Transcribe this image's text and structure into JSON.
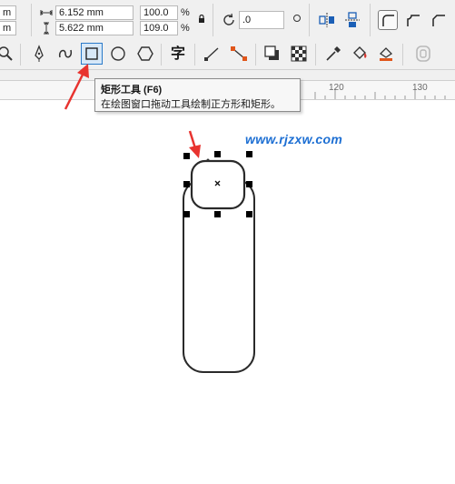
{
  "property_bar": {
    "x_value_fragment": "m",
    "y_value_fragment": "m",
    "width_value": "6.152 mm",
    "height_value": "5.622 mm",
    "scale_x": "100.0",
    "scale_y": "109.0",
    "percent_symbol": "%",
    "rotation_value": ".0",
    "icons": {
      "width": "width-arrows-icon",
      "height": "height-arrows-icon",
      "lock": "lock-ratio-icon",
      "rotate": "rotate-icon",
      "mirror_h": "mirror-horizontal-icon",
      "mirror_v": "mirror-vertical-icon",
      "corner_round": "round-corner-icon",
      "corner_scallop": "scalloped-corner-icon",
      "corner_chamfer": "chamfer-corner-icon"
    }
  },
  "toolbox": {
    "icons": [
      "zoom-icon",
      "pen-icon",
      "freehand-icon",
      "rectangle-tool-icon",
      "ellipse-tool-icon",
      "polygon-tool-icon",
      "text-tool-icon",
      "line-connector-icon",
      "connector-icon",
      "drop-shadow-icon",
      "transparency-icon",
      "eyedropper-icon",
      "fill-bucket-icon",
      "smart-fill-icon",
      "outline-icon"
    ],
    "text_tool_glyph": "字",
    "active": "rectangle-tool-icon"
  },
  "ruler": {
    "labels": [
      "120",
      "130"
    ]
  },
  "tooltip": {
    "title": "矩形工具 (F6)",
    "description": "在绘图窗口拖动工具绘制正方形和矩形。"
  },
  "watermark": {
    "text": "www.rjzxw.com"
  },
  "colors": {
    "accent_arrow": "#e8332f",
    "selection_blue": "#2a7ac9",
    "watermark": "#1d6fd3"
  }
}
